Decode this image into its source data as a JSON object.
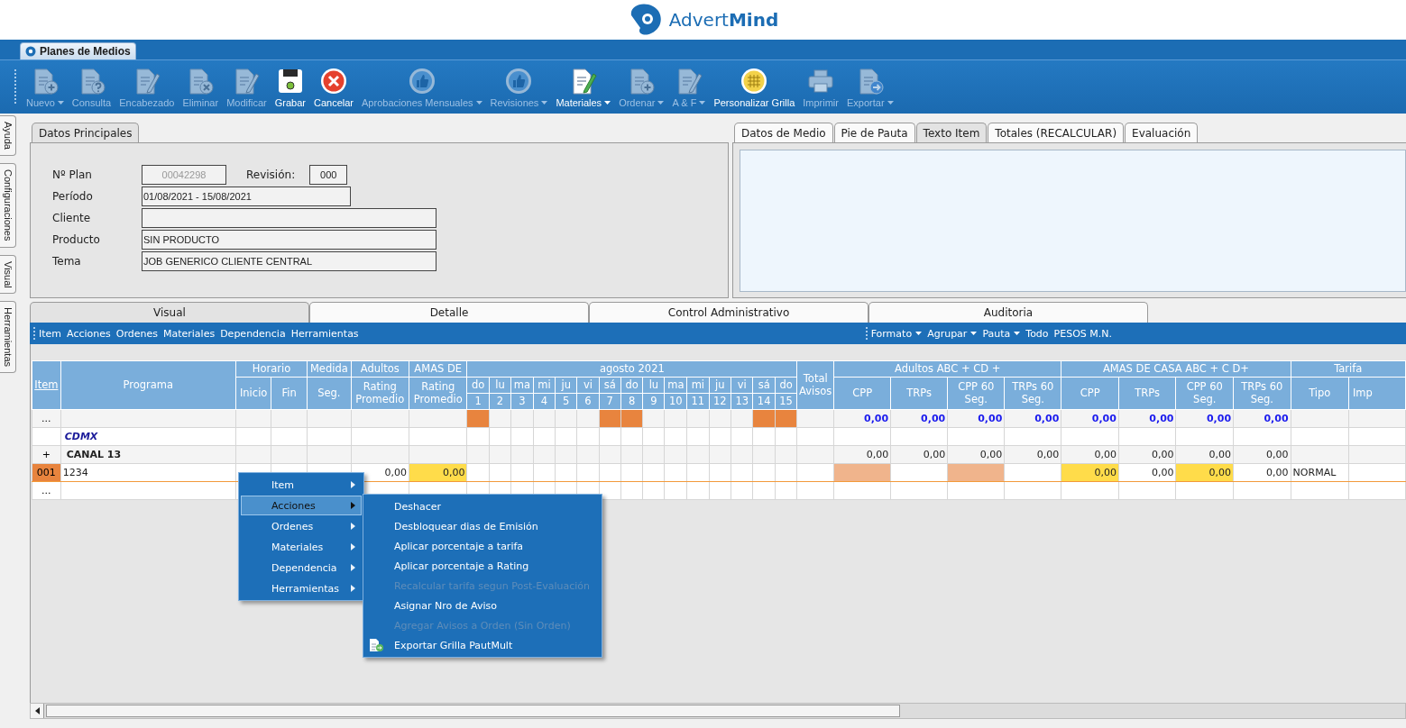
{
  "logo": "Advert**Mind**",
  "module_tab": "Planes de Medios",
  "toolbar": [
    {
      "label": "Nuevo",
      "kind": "new",
      "disabled": true,
      "has_menu": true
    },
    {
      "label": "Consulta",
      "kind": "query",
      "disabled": true,
      "has_menu": false
    },
    {
      "label": "Encabezado",
      "kind": "edit",
      "disabled": true,
      "has_menu": false
    },
    {
      "label": "Eliminar",
      "kind": "delete",
      "disabled": true,
      "has_menu": false
    },
    {
      "label": "Modificar",
      "kind": "edit",
      "disabled": true,
      "has_menu": false
    },
    {
      "label": "Grabar",
      "kind": "save",
      "disabled": false,
      "has_menu": false
    },
    {
      "label": "Cancelar",
      "kind": "cancel",
      "disabled": false,
      "has_menu": false
    },
    {
      "label": "Aprobaciones Mensuales",
      "kind": "approve",
      "disabled": true,
      "has_menu": true
    },
    {
      "label": "Revisiones",
      "kind": "approve",
      "disabled": true,
      "has_menu": true
    },
    {
      "label": "Materiales",
      "kind": "materials",
      "disabled": false,
      "has_menu": true
    },
    {
      "label": "Ordenar",
      "kind": "new",
      "disabled": true,
      "has_menu": true
    },
    {
      "label": "A & F",
      "kind": "edit",
      "disabled": true,
      "has_menu": true
    },
    {
      "label": "Personalizar Grilla",
      "kind": "grid",
      "disabled": false,
      "has_menu": false
    },
    {
      "label": "Imprimir",
      "kind": "print",
      "disabled": true,
      "has_menu": false
    },
    {
      "label": "Exportar",
      "kind": "export",
      "disabled": true,
      "has_menu": true
    }
  ],
  "side_tabs": [
    "Ayuda",
    "Configuraciones",
    "Visual",
    "Herramientas"
  ],
  "main_panel": {
    "tab": "Datos Principales",
    "plan": {
      "label": "Nº Plan",
      "value": "00042298",
      "disabled": true
    },
    "revision": {
      "label": "Revisión:",
      "value": "000"
    },
    "fields": [
      {
        "label": "Período",
        "value": "01/08/2021 - 15/08/2021",
        "kind": "short"
      },
      {
        "label": "Cliente",
        "kind": "long"
      },
      {
        "label": "Producto",
        "value": "SIN PRODUCTO",
        "kind": "long"
      },
      {
        "label": "Tema",
        "value": "JOB GENERICO CLIENTE CENTRAL",
        "kind": "long"
      }
    ]
  },
  "detail_tabs": [
    {
      "label": "Datos de Medio",
      "selected": false
    },
    {
      "label": "Pie de Pauta",
      "selected": false
    },
    {
      "label": "Texto Item",
      "selected": true
    },
    {
      "label": "Totales (RECALCULAR)",
      "selected": false
    },
    {
      "label": "Evaluación",
      "selected": false
    }
  ],
  "grid_tabs": [
    {
      "label": "Visual",
      "selected": true
    },
    {
      "label": "Detalle",
      "selected": false
    },
    {
      "label": "Control Administrativo",
      "selected": false
    },
    {
      "label": "Auditoria",
      "selected": false
    }
  ],
  "grid_menu": {
    "left": [
      "Item",
      "Acciones",
      "Ordenes",
      "Materiales",
      "Dependencia",
      "Herramientas"
    ],
    "right": [
      {
        "label": "Formato",
        "has_menu": true
      },
      {
        "label": "Agrupar",
        "has_menu": true
      },
      {
        "label": "Pauta",
        "has_menu": true
      },
      {
        "label": "Todo",
        "has_menu": false
      },
      {
        "label": "PESOS M.N.",
        "has_menu": false
      }
    ]
  },
  "grid": {
    "header": {
      "item": "Item",
      "programa": "Programa",
      "groups": [
        {
          "label": "Horario",
          "kind": "columns",
          "columns": [
            "Inicio",
            "Fin"
          ]
        },
        {
          "label": "Medida",
          "kind": "columns",
          "columns": [
            "Seg."
          ]
        },
        {
          "label": "Adultos",
          "kind": "columns",
          "columns": [
            "Rating Promedio"
          ]
        },
        {
          "label": "AMAS DE",
          "kind": "columns",
          "columns": [
            "Rating Promedio"
          ]
        },
        {
          "label": "agosto 2021",
          "kind": "days",
          "days": [
            {
              "weekday": "do",
              "day": "1"
            },
            {
              "weekday": "lu",
              "day": "2"
            },
            {
              "weekday": "ma",
              "day": "3"
            },
            {
              "weekday": "mi",
              "day": "4"
            },
            {
              "weekday": "ju",
              "day": "5"
            },
            {
              "weekday": "vi",
              "day": "6"
            },
            {
              "weekday": "sá",
              "day": "7"
            },
            {
              "weekday": "do",
              "day": "8"
            },
            {
              "weekday": "lu",
              "day": "9"
            },
            {
              "weekday": "ma",
              "day": "10"
            },
            {
              "weekday": "mi",
              "day": "11"
            },
            {
              "weekday": "ju",
              "day": "12"
            },
            {
              "weekday": "vi",
              "day": "13"
            },
            {
              "weekday": "sá",
              "day": "14"
            },
            {
              "weekday": "do",
              "day": "15"
            }
          ]
        },
        {
          "label": "Total Avisos",
          "kind": "single"
        },
        {
          "label": "Adultos ABC + CD +",
          "kind": "columns",
          "columns": [
            "CPP",
            "TRPs",
            "CPP 60 Seg.",
            "TRPs 60 Seg."
          ]
        },
        {
          "label": "AMAS DE CASA ABC + C D+",
          "kind": "columns",
          "columns": [
            "CPP",
            "TRPs",
            "CPP 60 Seg.",
            "TRPs 60 Seg."
          ]
        },
        {
          "label": "Tarifa",
          "kind": "columns",
          "columns": [
            "Tipo",
            "Imp"
          ]
        }
      ]
    },
    "rows": [
      {
        "kind": "totals",
        "selected": false,
        "item": "...",
        "days": [
          true,
          false,
          false,
          false,
          false,
          false,
          true,
          true,
          false,
          false,
          false,
          false,
          false,
          true,
          true
        ],
        "metrics": [
          {
            "value": "0,00"
          },
          {
            "value": "0,00"
          },
          {
            "value": "0,00"
          },
          {
            "value": "0,00"
          },
          {
            "value": "0,00"
          },
          {
            "value": "0,00"
          },
          {
            "value": "0,00"
          },
          {
            "value": "0,00"
          }
        ]
      },
      {
        "kind": "group",
        "selected": false,
        "programa": "CDMX"
      },
      {
        "kind": "subgroup",
        "selected": false,
        "item": "+",
        "programa": "CANAL 13",
        "metrics": [
          {
            "value": "0,00"
          },
          {
            "value": "0,00"
          },
          {
            "value": "0,00"
          },
          {
            "value": "0,00"
          },
          {
            "value": "0,00"
          },
          {
            "value": "0,00"
          },
          {
            "value": "0,00"
          },
          {
            "value": "0,00"
          }
        ]
      },
      {
        "kind": "item",
        "selected": true,
        "item": "001",
        "programa": "1234",
        "ratings": [
          {
            "value": "0,00"
          },
          {
            "value": "0,00",
            "color": "#ffdc4a"
          }
        ],
        "metrics": [
          {
            "kind": "fill",
            "color": "#f0b48c"
          },
          {
            "kind": "blank"
          },
          {
            "kind": "fill",
            "color": "#f0b48c"
          },
          {
            "kind": "blank"
          },
          {
            "kind": "number",
            "value": "0,00",
            "color": "#ffdc4a"
          },
          {
            "kind": "number",
            "value": "0,00"
          },
          {
            "kind": "number",
            "value": "0,00",
            "color": "#ffdc4a"
          },
          {
            "kind": "number",
            "value": "0,00"
          }
        ],
        "tipo": "NORMAL"
      },
      {
        "kind": "new",
        "selected": false,
        "item": "..."
      }
    ]
  },
  "context_menu": {
    "items": [
      {
        "label": "Item",
        "selected": false
      },
      {
        "label": "Acciones",
        "selected": true
      },
      {
        "label": "Ordenes",
        "selected": false
      },
      {
        "label": "Materiales",
        "selected": false
      },
      {
        "label": "Dependencia",
        "selected": false
      },
      {
        "label": "Herramientas",
        "selected": false
      }
    ],
    "submenu": [
      {
        "label": "Deshacer",
        "disabled": false
      },
      {
        "label": "Desbloquear dias de Emisión",
        "disabled": false
      },
      {
        "label": "Aplicar porcentaje a tarifa",
        "disabled": false
      },
      {
        "label": "Aplicar porcentaje a Rating",
        "disabled": false
      },
      {
        "label": "Recalcular tarifa segun Post-Evaluación",
        "disabled": true
      },
      {
        "label": "Asignar Nro de Aviso",
        "disabled": false
      },
      {
        "label": "Agregar Avisos a Orden (Sin Orden)",
        "disabled": true
      },
      {
        "label": "Exportar Grilla PautMult",
        "disabled": false,
        "kind": "export"
      }
    ]
  }
}
